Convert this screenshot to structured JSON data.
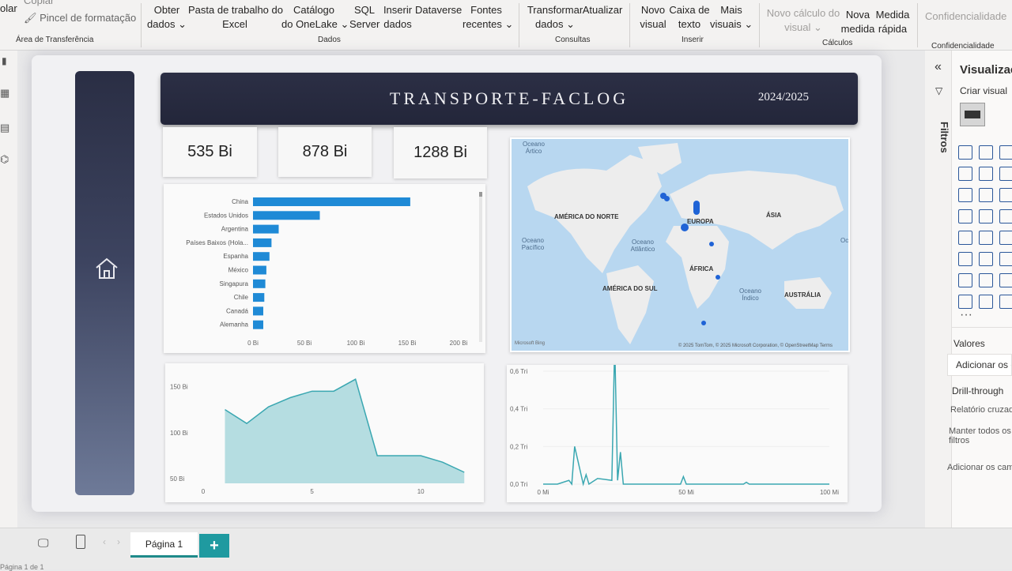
{
  "ribbon": {
    "clipboard": {
      "copy": "Copiar",
      "format_painter": "Pincel de formatação",
      "group": "Área de Transferência",
      "paste_fragment": "olar"
    },
    "data": {
      "get_data": [
        "Obter",
        "dados ⌄"
      ],
      "excel": [
        "Pasta de trabalho do",
        "Excel"
      ],
      "onelake": [
        "Catálogo",
        "do OneLake ⌄"
      ],
      "sql": [
        "SQL",
        "Server"
      ],
      "enter_data": [
        "Inserir",
        "dados"
      ],
      "dataverse": "Dataverse",
      "recent": [
        "Fontes",
        "recentes ⌄"
      ],
      "group": "Dados"
    },
    "queries": {
      "transform": [
        "Transformar",
        "dados ⌄"
      ],
      "refresh": "Atualizar",
      "group": "Consultas"
    },
    "insert": {
      "new_visual": [
        "Novo",
        "visual"
      ],
      "text_box": [
        "Caixa de",
        "texto"
      ],
      "more_visuals": [
        "Mais",
        "visuais ⌄"
      ],
      "group": "Inserir"
    },
    "calculations": {
      "new_calc": [
        "Novo cálculo do",
        "visual ⌄"
      ],
      "new_measure": [
        "Nova",
        "medida"
      ],
      "quick_measure": [
        "Medida",
        "rápida"
      ],
      "group": "Cálculos"
    },
    "sensitivity": {
      "label": "Confidencialidade",
      "group": "Confidencialidade"
    }
  },
  "report": {
    "title": "TRANSPORTE-FACLOG",
    "year": "2024/2025",
    "kpis": [
      "535 Bi",
      "878 Bi",
      "1288 Bi"
    ]
  },
  "chart_data": [
    {
      "type": "bar",
      "orientation": "horizontal",
      "categories": [
        "China",
        "Estados Unidos",
        "Argentina",
        "Países Baixos (Hola...",
        "Espanha",
        "México",
        "Singapura",
        "Chile",
        "Canadá",
        "Alemanha"
      ],
      "values": [
        153,
        65,
        25,
        18,
        16,
        13,
        12,
        11,
        10,
        10
      ],
      "xticks": [
        "0 Bi",
        "50 Bi",
        "100 Bi",
        "150 Bi",
        "200 Bi"
      ],
      "xlim": [
        0,
        200
      ]
    },
    {
      "type": "area",
      "x": [
        1,
        2,
        3,
        4,
        5,
        6,
        7,
        8,
        9,
        10,
        11,
        12
      ],
      "values": [
        125,
        110,
        128,
        138,
        145,
        145,
        158,
        75,
        75,
        75,
        68,
        57
      ],
      "xticks": [
        "0",
        "5",
        "10"
      ],
      "yticks": [
        "50 Bi",
        "100 Bi",
        "150 Bi"
      ],
      "xlim": [
        0,
        12.5
      ],
      "ylim": [
        45,
        165
      ]
    },
    {
      "type": "line",
      "x": [
        0,
        5,
        9,
        10,
        11,
        14,
        15,
        16,
        19,
        24,
        25,
        26,
        27,
        28,
        30,
        40,
        48,
        49,
        50,
        52,
        60,
        70,
        71,
        72,
        80,
        100
      ],
      "values": [
        0,
        0,
        0.02,
        0,
        0.2,
        0,
        0.05,
        0,
        0.03,
        0.02,
        0.75,
        0.02,
        0.17,
        0,
        0,
        0,
        0,
        0.04,
        0,
        0,
        0,
        0,
        0.01,
        0,
        0,
        0
      ],
      "xticks": [
        "0 Mi",
        "50 Mi",
        "100 Mi"
      ],
      "yticks": [
        "0,0 Tri",
        "0,2 Tri",
        "0,4 Tri",
        "0,6 Tri"
      ],
      "xlim": [
        0,
        100
      ],
      "ylim": [
        0,
        0.6
      ]
    }
  ],
  "map": {
    "continents": [
      "AMÉRICA DO NORTE",
      "EUROPA",
      "ÁSIA",
      "ÁFRICA",
      "AMÉRICA DO SUL",
      "AUSTRÁLIA"
    ],
    "oceans": [
      "Oceano Ártico",
      "Oceano Pacífico",
      "Oceano Atlântico",
      "Oceano Índico",
      "Oce..."
    ],
    "copyright": "© 2025 TomTom, © 2025 Microsoft Corporation, © OpenStreetMap  Terms",
    "brand": "Microsoft Bing"
  },
  "right_pane": {
    "filters": "Filtros",
    "visualizations": "Visualizações",
    "build_visual": "Criar visual",
    "values": "Valores",
    "add_data": "Adicionar os campos de dados",
    "drill_through": "Drill-through",
    "cross_report": "Relatório cruzado",
    "keep_filters": [
      "Manter todos os",
      "filtros"
    ],
    "add_drill": "Adicionar os campos"
  },
  "pages": {
    "tab": "Página 1",
    "add": "+",
    "status": "Página 1 de 1"
  },
  "colors": {
    "accent": "#1f8ad6",
    "header": "#2c2f45",
    "area": "#7cc5cc",
    "teal": "#1f9aa0"
  }
}
